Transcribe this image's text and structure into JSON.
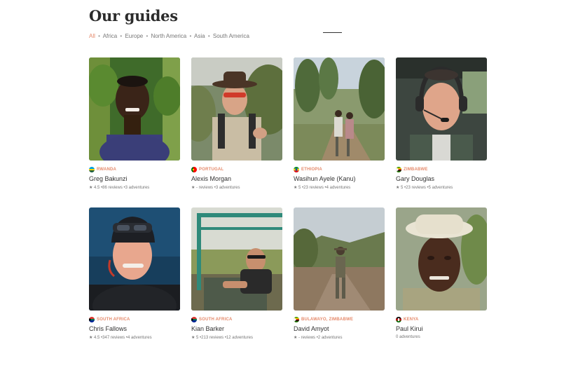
{
  "page": {
    "title": "Our guides"
  },
  "filters": {
    "items": [
      {
        "label": "All",
        "active": true
      },
      {
        "label": "Africa",
        "active": false
      },
      {
        "label": "Europe",
        "active": false
      },
      {
        "label": "North America",
        "active": false
      },
      {
        "label": "Asia",
        "active": false
      },
      {
        "label": "South America",
        "active": false
      }
    ],
    "separator": "•"
  },
  "guides": [
    {
      "name": "Greg Bakunzi",
      "country": "RWANDA",
      "meta": "★ 4.5 •86 reviews •3 adventures",
      "flag_colors": [
        "#20603d",
        "#fad201",
        "#00a1de"
      ]
    },
    {
      "name": "Alexis Morgan",
      "country": "PORTUGAL",
      "meta": "★ - reviews •3 adventures",
      "flag_colors": [
        "#006600",
        "#ff0000",
        "#ffcc00"
      ]
    },
    {
      "name": "Wasihun Ayele (Kanu)",
      "country": "ETHIOPIA",
      "meta": "★ 5 •23 reviews •4 adventures",
      "flag_colors": [
        "#078930",
        "#fcdd09",
        "#da121a"
      ]
    },
    {
      "name": "Gary Douglas",
      "country": "ZIMBABWE",
      "meta": "★ 5 •23 reviews •5 adventures",
      "flag_colors": [
        "#319208",
        "#ffd200",
        "#de2010"
      ]
    },
    {
      "name": "Chris Fallows",
      "country": "SOUTH AFRICA",
      "meta": "★ 4.5 •347 reviews •4 adventures",
      "flag_colors": [
        "#007a4d",
        "#de3831",
        "#002395"
      ]
    },
    {
      "name": "Kian Barker",
      "country": "SOUTH AFRICA",
      "meta": "★ 5 •213 reviews •12 adventures",
      "flag_colors": [
        "#007a4d",
        "#de3831",
        "#002395"
      ]
    },
    {
      "name": "David Amyot",
      "country": "BULAWAYO, ZIMBABWE",
      "meta": "★ - reviews •2 adventures",
      "flag_colors": [
        "#319208",
        "#ffd200",
        "#de2010"
      ]
    },
    {
      "name": "Paul Kirui",
      "country": "KENYA",
      "meta": "0 adventures",
      "flag_colors": [
        "#000000",
        "#bb0000",
        "#006600"
      ]
    }
  ]
}
